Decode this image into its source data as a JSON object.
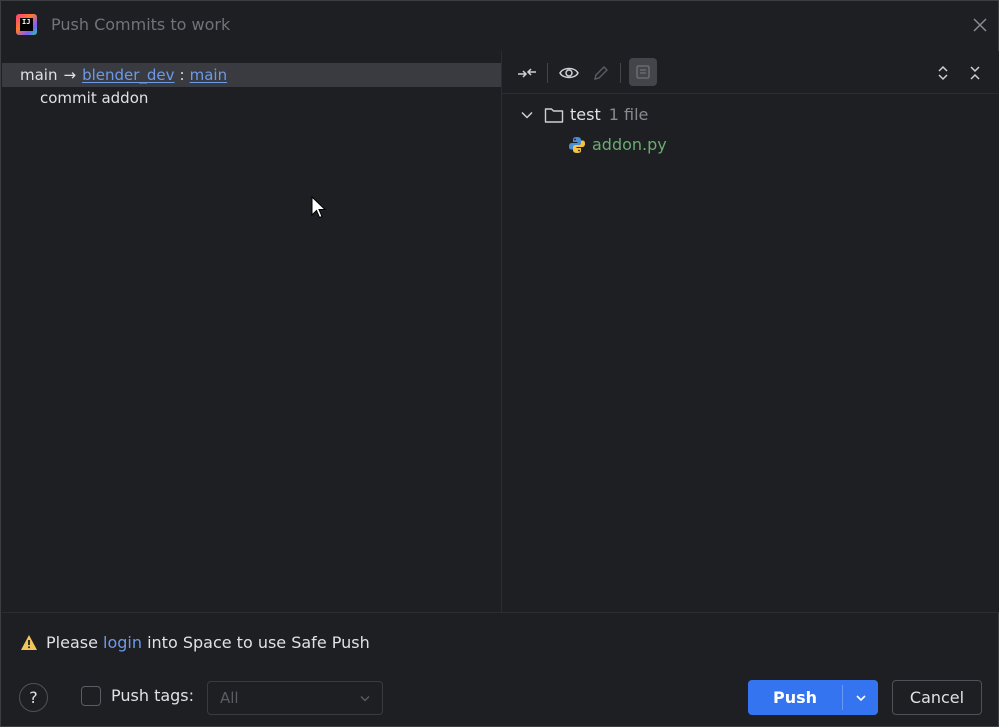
{
  "window": {
    "title": "Push Commits to work"
  },
  "left": {
    "branch_local": "main",
    "branch_arrow": "→",
    "remote_name": "blender_dev",
    "separator": ":",
    "remote_branch": "main",
    "commit_message": "commit addon"
  },
  "right": {
    "tree": {
      "folder_name": "test",
      "folder_count": "1 file",
      "file_name": "addon.py"
    }
  },
  "footer": {
    "warning_prefix": "Please ",
    "warning_link": "login",
    "warning_suffix": " into Space to use Safe Push",
    "help_label": "?",
    "push_tags_label": "Push tags:",
    "push_tags_checked": false,
    "push_tags_value": "All",
    "push_label": "Push",
    "cancel_label": "Cancel"
  },
  "colors": {
    "accent": "#3574f0",
    "link": "#6c9ae8",
    "file_added": "#6aab73",
    "warning": "#f2c55c"
  }
}
